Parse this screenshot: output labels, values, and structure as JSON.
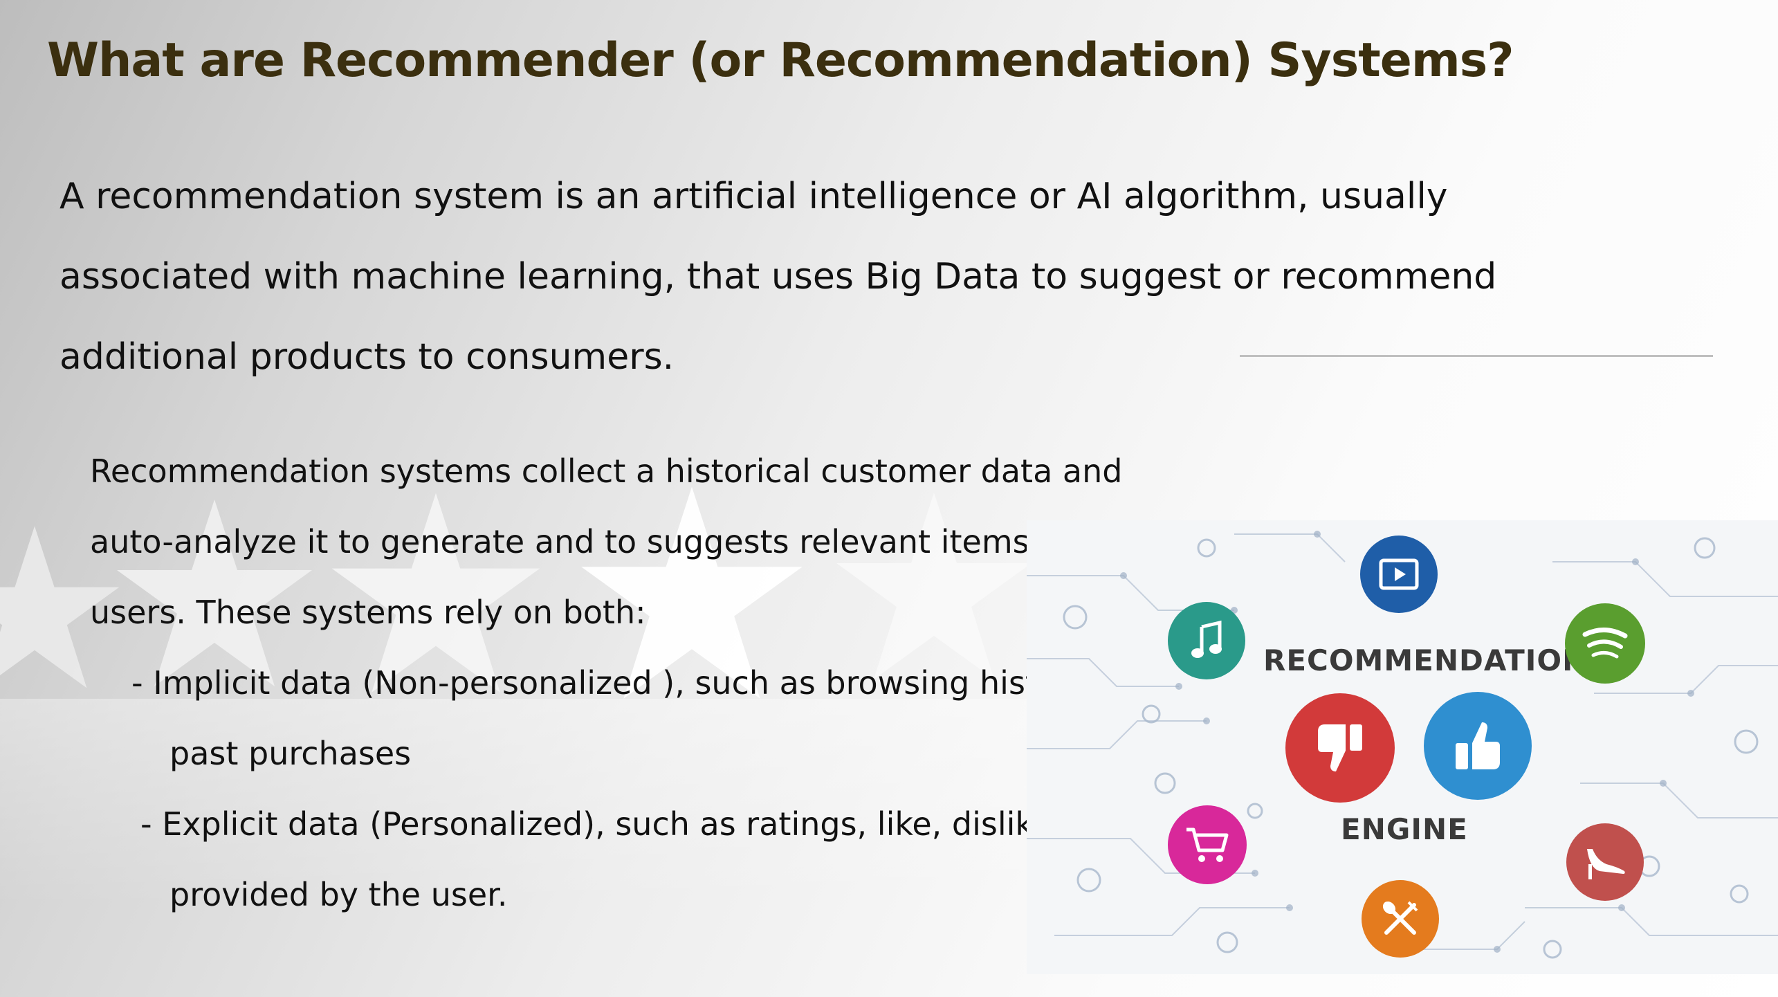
{
  "slide": {
    "title": "What are Recommender  (or Recommendation)  Systems?",
    "intro_lines": [
      "A recommendation system is an artificial intelligence or AI algorithm, usually",
      "associated with machine learning, that uses  Big Data to suggest or recommend",
      "additional products to consumers."
    ],
    "body_lines": [
      "Recommendation systems collect a historical  customer data and",
      "auto-analyze it to generate and to suggests relevant items for new",
      "users. These systems rely on both:"
    ],
    "bullets": [
      {
        "line1": "-  Implicit data (Non-personalized ), such as browsing history and",
        "line2": "past purchases"
      },
      {
        "line1": "- Explicit data (Personalized), such as ratings, like, dislike",
        "line2": "provided by the user."
      }
    ]
  },
  "image": {
    "label_top": "RECOMMENDATION",
    "label_bottom": "ENGINE",
    "icons": [
      {
        "name": "video-icon",
        "color": "#1f5ea8"
      },
      {
        "name": "music-note-icon",
        "color": "#2a9a8a"
      },
      {
        "name": "spotify-icon",
        "color": "#5a9e2f"
      },
      {
        "name": "thumbs-down-icon",
        "color": "#d23a3a"
      },
      {
        "name": "thumbs-up-icon",
        "color": "#2f8fd0"
      },
      {
        "name": "shopping-cart-icon",
        "color": "#d8289a"
      },
      {
        "name": "high-heel-icon",
        "color": "#c0504d"
      },
      {
        "name": "fork-spoon-icon",
        "color": "#e47b1e"
      }
    ]
  },
  "colors": {
    "title": "#3b2f0f",
    "text": "#111111",
    "divider": "#bfbfbf"
  }
}
